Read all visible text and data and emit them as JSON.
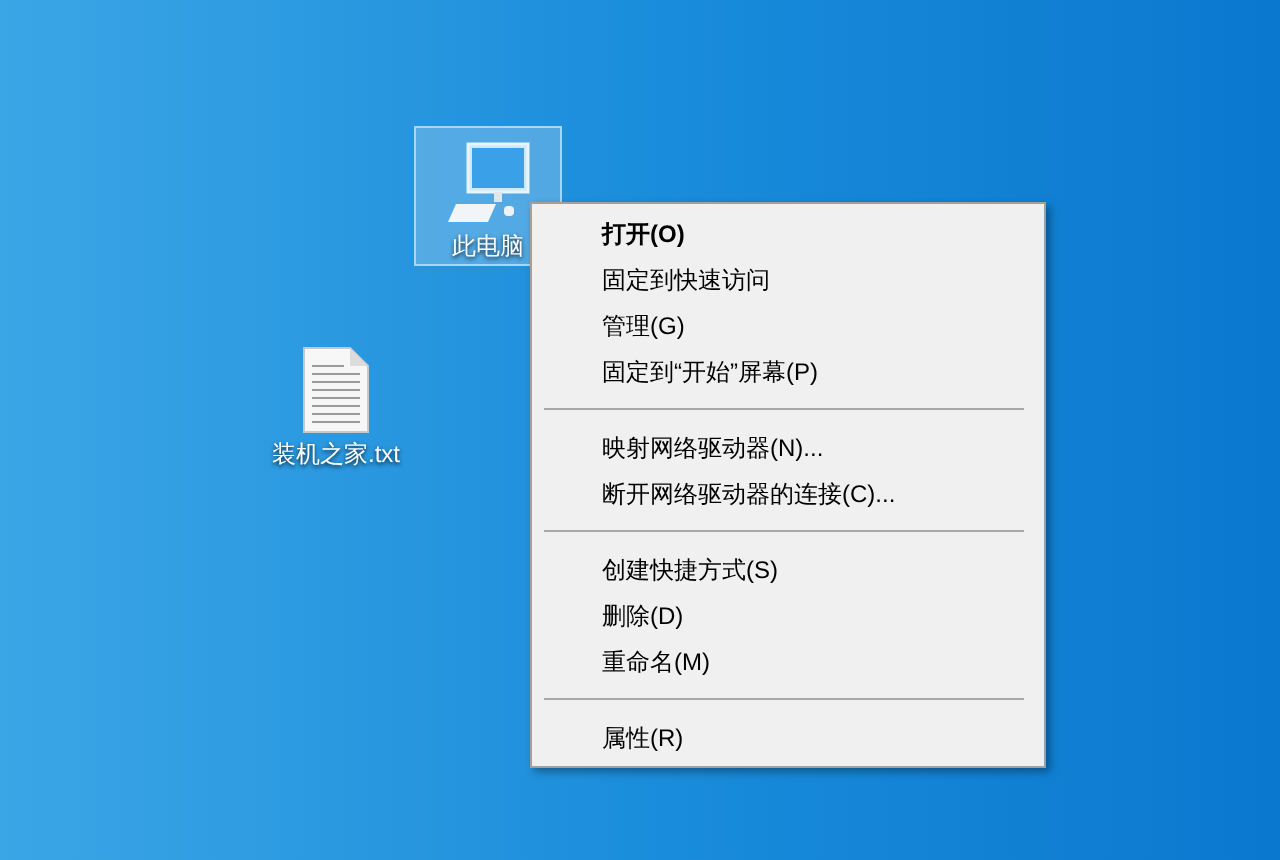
{
  "desktop_icons": [
    {
      "label": "此电脑",
      "kind": "computer",
      "selected": true
    },
    {
      "label": "装机之家.txt",
      "kind": "text_file",
      "selected": false
    }
  ],
  "context_menu": {
    "groups": [
      [
        {
          "label": "打开(O)",
          "default": true
        },
        {
          "label": "固定到快速访问",
          "default": false
        },
        {
          "label": "管理(G)",
          "default": false
        },
        {
          "label": "固定到“开始”屏幕(P)",
          "default": false
        }
      ],
      [
        {
          "label": "映射网络驱动器(N)...",
          "default": false
        },
        {
          "label": "断开网络驱动器的连接(C)...",
          "default": false
        }
      ],
      [
        {
          "label": "创建快捷方式(S)",
          "default": false
        },
        {
          "label": "删除(D)",
          "default": false
        },
        {
          "label": "重命名(M)",
          "default": false
        }
      ],
      [
        {
          "label": "属性(R)",
          "default": false
        }
      ]
    ]
  }
}
